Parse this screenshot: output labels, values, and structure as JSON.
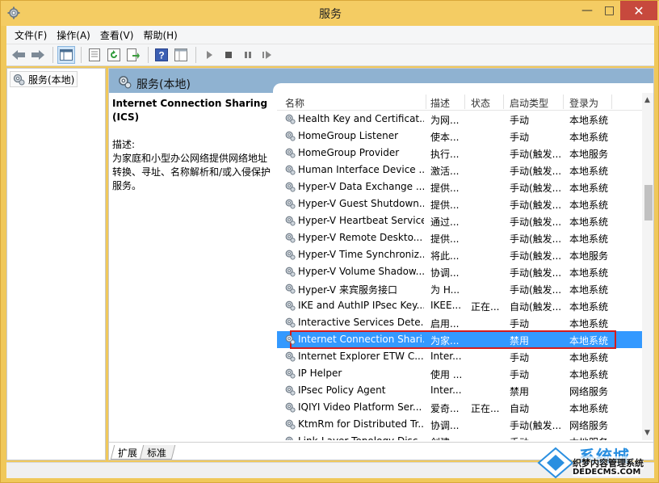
{
  "window": {
    "title": "服务",
    "controls": {
      "minimize": "—",
      "maximize": "□",
      "close": "✕"
    }
  },
  "menu": [
    "文件(F)",
    "操作(A)",
    "查看(V)",
    "帮助(H)"
  ],
  "tree": {
    "item": "服务(本地)"
  },
  "pane": {
    "header": "服务(本地)",
    "selected_name": "Internet Connection Sharing (ICS)",
    "desc_label": "描述:",
    "desc_text": "为家庭和小型办公网络提供网络地址转换、寻址、名称解析和/或入侵保护服务。"
  },
  "columns": {
    "name": "名称",
    "desc": "描述",
    "status": "状态",
    "start": "启动类型",
    "logon": "登录为"
  },
  "services": [
    {
      "name": "Health Key and Certificat...",
      "desc": "为网...",
      "status": "",
      "start": "手动",
      "logon": "本地系统"
    },
    {
      "name": "HomeGroup Listener",
      "desc": "使本...",
      "status": "",
      "start": "手动",
      "logon": "本地系统"
    },
    {
      "name": "HomeGroup Provider",
      "desc": "执行...",
      "status": "",
      "start": "手动(触发...",
      "logon": "本地服务"
    },
    {
      "name": "Human Interface Device ...",
      "desc": "激活...",
      "status": "",
      "start": "手动(触发...",
      "logon": "本地系统"
    },
    {
      "name": "Hyper-V Data Exchange ...",
      "desc": "提供...",
      "status": "",
      "start": "手动(触发...",
      "logon": "本地系统"
    },
    {
      "name": "Hyper-V Guest Shutdown...",
      "desc": "提供...",
      "status": "",
      "start": "手动(触发...",
      "logon": "本地系统"
    },
    {
      "name": "Hyper-V Heartbeat Service",
      "desc": "通过...",
      "status": "",
      "start": "手动(触发...",
      "logon": "本地系统"
    },
    {
      "name": "Hyper-V Remote Deskto...",
      "desc": "提供...",
      "status": "",
      "start": "手动(触发...",
      "logon": "本地系统"
    },
    {
      "name": "Hyper-V Time Synchroniz...",
      "desc": "将此...",
      "status": "",
      "start": "手动(触发...",
      "logon": "本地服务"
    },
    {
      "name": "Hyper-V Volume Shadow...",
      "desc": "协调...",
      "status": "",
      "start": "手动(触发...",
      "logon": "本地系统"
    },
    {
      "name": "Hyper-V 来宾服务接口",
      "desc": "为 H...",
      "status": "",
      "start": "手动(触发...",
      "logon": "本地系统"
    },
    {
      "name": "IKE and AuthIP IPsec Key...",
      "desc": "IKEE...",
      "status": "正在...",
      "start": "自动(触发...",
      "logon": "本地系统"
    },
    {
      "name": "Interactive Services Dete...",
      "desc": "启用...",
      "status": "",
      "start": "手动",
      "logon": "本地系统"
    },
    {
      "name": "Internet Connection Shari...",
      "desc": "为家...",
      "status": "",
      "start": "禁用",
      "logon": "本地系统",
      "selected": true
    },
    {
      "name": "Internet Explorer ETW C...",
      "desc": "Inter...",
      "status": "",
      "start": "手动",
      "logon": "本地系统"
    },
    {
      "name": "IP Helper",
      "desc": "使用 ...",
      "status": "",
      "start": "手动",
      "logon": "本地系统"
    },
    {
      "name": "IPsec Policy Agent",
      "desc": "Inter...",
      "status": "",
      "start": "禁用",
      "logon": "网络服务"
    },
    {
      "name": "IQIYI Video Platform Ser...",
      "desc": "爱奇...",
      "status": "正在...",
      "start": "自动",
      "logon": "本地系统"
    },
    {
      "name": "KtmRm for Distributed Tr...",
      "desc": "协调...",
      "status": "",
      "start": "手动(触发...",
      "logon": "网络服务"
    },
    {
      "name": "Link-Layer Topology Disc...",
      "desc": "创建...",
      "status": "",
      "start": "手动",
      "logon": "本地服务"
    }
  ],
  "tabs": [
    "扩展",
    "标准"
  ],
  "watermark": {
    "cn": "系统城",
    "line1": "织梦内容管理系统",
    "line2": "DEDECMS.COM"
  }
}
